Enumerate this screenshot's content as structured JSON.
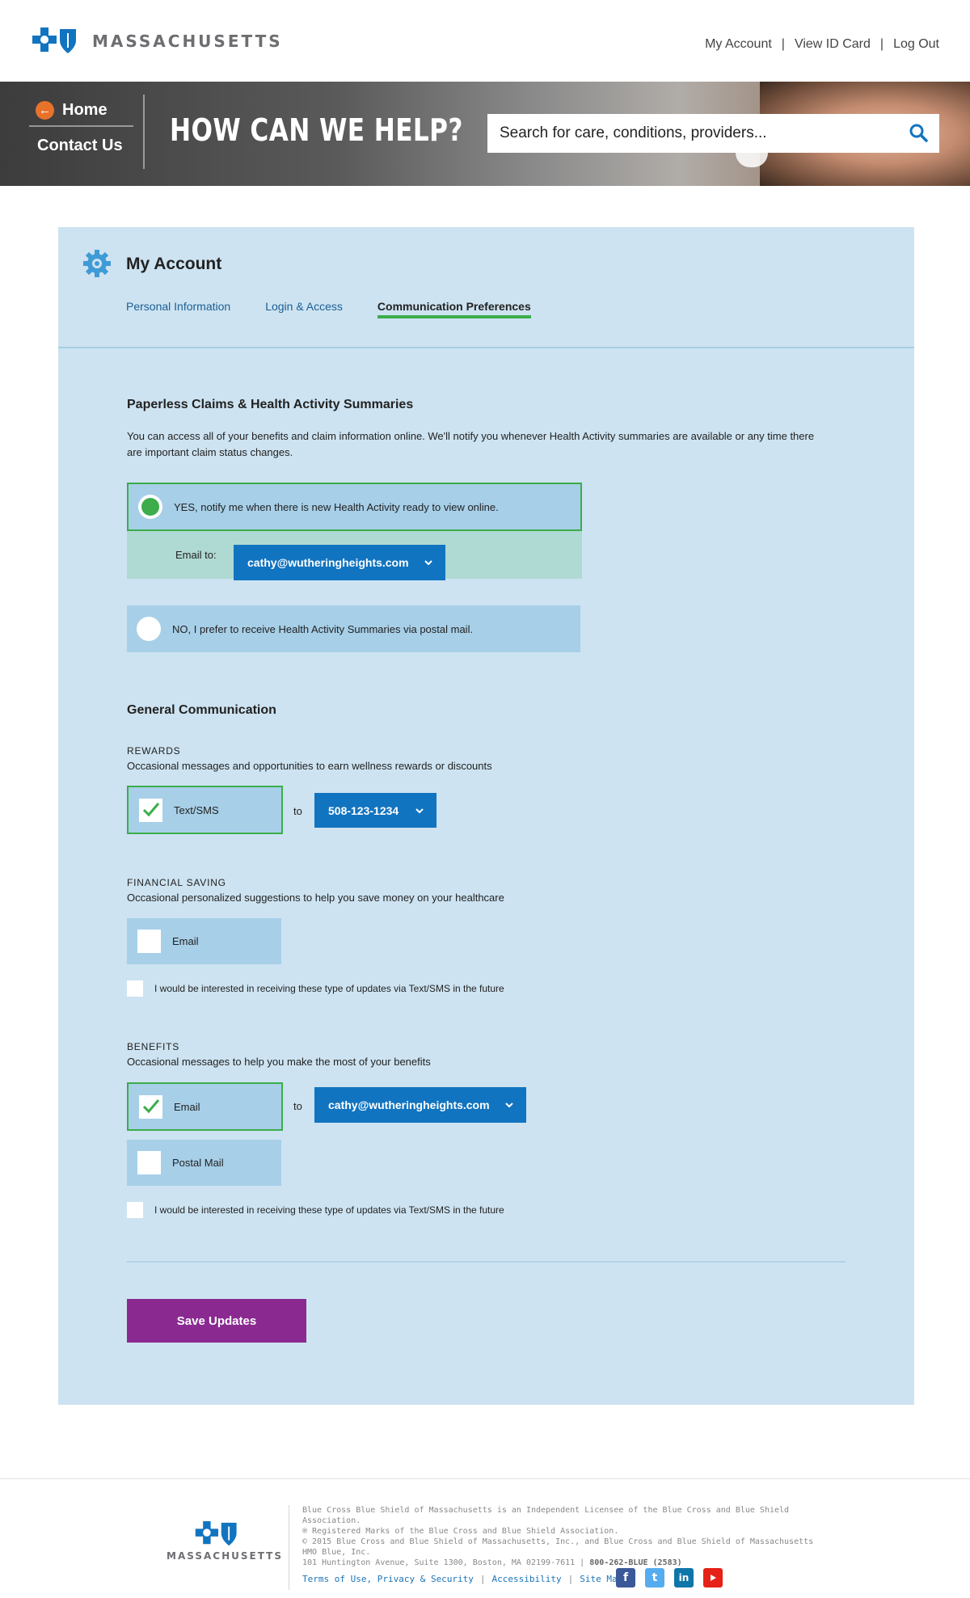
{
  "brand": {
    "name": "MASSACHUSETTS",
    "logo_icon": "bcbs-cross-shield-icon",
    "color": "#1174c0"
  },
  "topnav": {
    "my_account": "My Account",
    "view_id_card": "View ID Card",
    "log_out": "Log Out",
    "separator": "|"
  },
  "hero": {
    "home": "Home",
    "contact_us": "Contact Us",
    "title": "HOW CAN WE HELP?",
    "search_placeholder": "Search for care, conditions, providers...",
    "search_icon": "search-icon"
  },
  "account": {
    "title": "My Account",
    "tabs": [
      {
        "label": "Personal Information",
        "active": false
      },
      {
        "label": "Login & Access",
        "active": false
      },
      {
        "label": "Communication Preferences",
        "active": true
      }
    ]
  },
  "paperless": {
    "heading": "Paperless Claims & Health Activity Summaries",
    "description": "You can access all of your benefits and claim information online.  We'll notify you whenever Health Activity summaries are available or any time there are important claim status changes.",
    "option_yes": "YES, notify me when there is new Health Activity ready to view online.",
    "option_yes_selected": true,
    "email_to_label": "Email to:",
    "email_value": "cathy@wutheringheights.com",
    "option_no": "NO, I prefer to receive Health Activity Summaries via postal mail.",
    "option_no_selected": false
  },
  "general": {
    "heading": "General Communication",
    "to_label": "to",
    "rewards": {
      "title": "REWARDS",
      "description": "Occasional messages and opportunities to earn wellness rewards or discounts",
      "channel": "Text/SMS",
      "checked": true,
      "phone": "508-123-1234"
    },
    "financial": {
      "title": "FINANCIAL SAVING",
      "description": "Occasional personalized suggestions to help you save money on your healthcare",
      "channel": "Email",
      "checked": false,
      "sms_interest": "I would be interested in receiving these type of updates via Text/SMS in the future"
    },
    "benefits": {
      "title": "BENEFITS",
      "description": "Occasional messages to help you make the most of your benefits",
      "channel_email": "Email",
      "email_checked": true,
      "email_value": "cathy@wutheringheights.com",
      "channel_postal": "Postal Mail",
      "postal_checked": false,
      "sms_interest": "I would be interested in receiving these type of updates via Text/SMS in the future"
    }
  },
  "save_button": "Save Updates",
  "colors": {
    "panel_bg": "#cde3f1",
    "option_bg": "#a7cfe8",
    "accent_green": "#3cad4a",
    "dropdown_blue": "#1174c0",
    "save_purple": "#8a2a91"
  },
  "footer": {
    "brand": "MASSACHUSETTS",
    "legal_1": "Blue Cross Blue Shield of Massachusetts is an Independent Licensee of the Blue Cross and Blue Shield Association.",
    "legal_2": "® Registered Marks of the Blue Cross and Blue Shield Association.",
    "legal_3": "© 2015 Blue Cross and Blue Shield of Massachusetts, Inc., and Blue Cross and Blue Shield of Massachusetts HMO Blue, Inc.",
    "legal_4": "101 Huntington Avenue, Suite 1300, Boston, MA 02199-7611 |",
    "phone": "800-262-BLUE (2583)",
    "links": [
      "Terms of Use, Privacy & Security",
      "Accessibility",
      "Site Map"
    ],
    "social": [
      "facebook-icon",
      "twitter-icon",
      "linkedin-icon",
      "youtube-icon"
    ]
  }
}
